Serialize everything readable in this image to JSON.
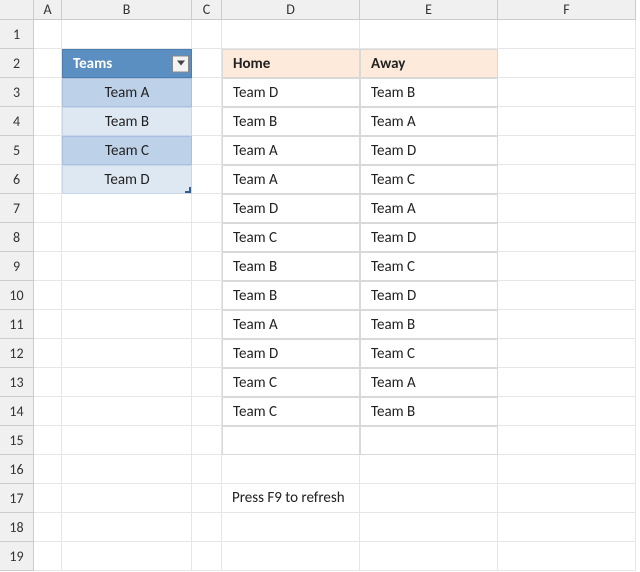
{
  "columns": [
    "A",
    "B",
    "C",
    "D",
    "E",
    "F"
  ],
  "rows": [
    "1",
    "2",
    "3",
    "4",
    "5",
    "6",
    "7",
    "8",
    "9",
    "10",
    "11",
    "12",
    "13",
    "14",
    "15",
    "16",
    "17",
    "18",
    "19"
  ],
  "teams_table": {
    "header": "Teams",
    "rows": [
      "Team A",
      "Team B",
      "Team C",
      "Team D"
    ]
  },
  "schedule_table": {
    "headers": {
      "home": "Home",
      "away": "Away"
    },
    "rows": [
      {
        "home": "Team D",
        "away": "Team B"
      },
      {
        "home": "Team B",
        "away": "Team A"
      },
      {
        "home": "Team A",
        "away": "Team D"
      },
      {
        "home": "Team A",
        "away": "Team C"
      },
      {
        "home": "Team D",
        "away": "Team A"
      },
      {
        "home": "Team C",
        "away": "Team D"
      },
      {
        "home": "Team B",
        "away": "Team C"
      },
      {
        "home": "Team B",
        "away": "Team D"
      },
      {
        "home": "Team A",
        "away": "Team B"
      },
      {
        "home": "Team D",
        "away": "Team C"
      },
      {
        "home": "Team C",
        "away": "Team A"
      },
      {
        "home": "Team C",
        "away": "Team B"
      }
    ]
  },
  "note": "Press F9 to refresh"
}
